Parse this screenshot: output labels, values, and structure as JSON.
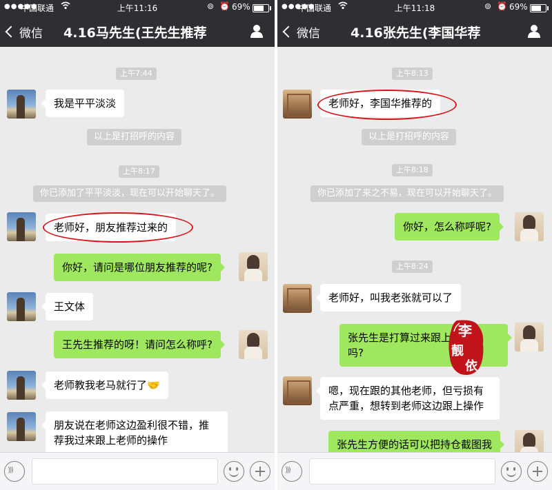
{
  "colors": {
    "header": "#2e2e33",
    "chat_bg": "#ebebeb",
    "bubble_out": "#9fe75e",
    "bubble_in": "#ffffff",
    "highlight_ellipse": "#d8141a",
    "stamp": "#c0141a"
  },
  "left": {
    "status": {
      "signal": "●●●●●",
      "carrier": "中国联通",
      "time": "上午11:16",
      "battery": "69%",
      "battery_level": 0.69
    },
    "nav": {
      "back_label": "微信",
      "title": "4.16马先生(王先生推荐",
      "person_icon": "person-icon"
    },
    "messages": {
      "t1": "上午7:44",
      "m1": "我是平平淡淡",
      "s1": "以上是打招呼的内容",
      "t2": "上午8:17",
      "s2": "你已添加了平平淡淡，现在可以开始聊天了。",
      "m2": "老师好，朋友推荐过来的",
      "m3": "你好，请问是哪位朋友推荐的呢?",
      "m4": "王文体",
      "m5": "王先生推荐的呀！请问怎么称呼?",
      "m6": "老师教我老马就行了",
      "m6_emoji": "🤝",
      "m7_line1": "朋友说在老师这边盈利很不错，推",
      "m7_line2": "荐我过来跟上老师的操作"
    }
  },
  "right": {
    "status": {
      "signal": "●●●●●",
      "carrier": "中国联通",
      "time": "上午11:18",
      "battery": "69%",
      "battery_level": 0.69
    },
    "nav": {
      "back_label": "微信",
      "title": "4.16张先生(李国华荐",
      "person_icon": "person-icon"
    },
    "messages": {
      "t1": "上午8:13",
      "m1": "老师好，李国华推荐的",
      "s1": "以上是打招呼的内容",
      "t2": "上午8:18",
      "s2": "你已添加了来之不易，现在可以开始聊天了。",
      "m2": "你好，怎么称呼呢?",
      "t3": "上午8:24",
      "m3": "老师好，叫我老张就可以了",
      "m4_line1": "张先生是打算过来跟上操作",
      "m4_line2": "吗?",
      "m5_line1": "嗯，现在跟的其他老师，但亏损有",
      "m5_line2": "点严重，想转到老师这边跟上操作",
      "m6": "张先生方便的话可以把持仓截图我"
    }
  },
  "watermark": {
    "chars": [
      "李",
      "靓",
      "依"
    ]
  }
}
